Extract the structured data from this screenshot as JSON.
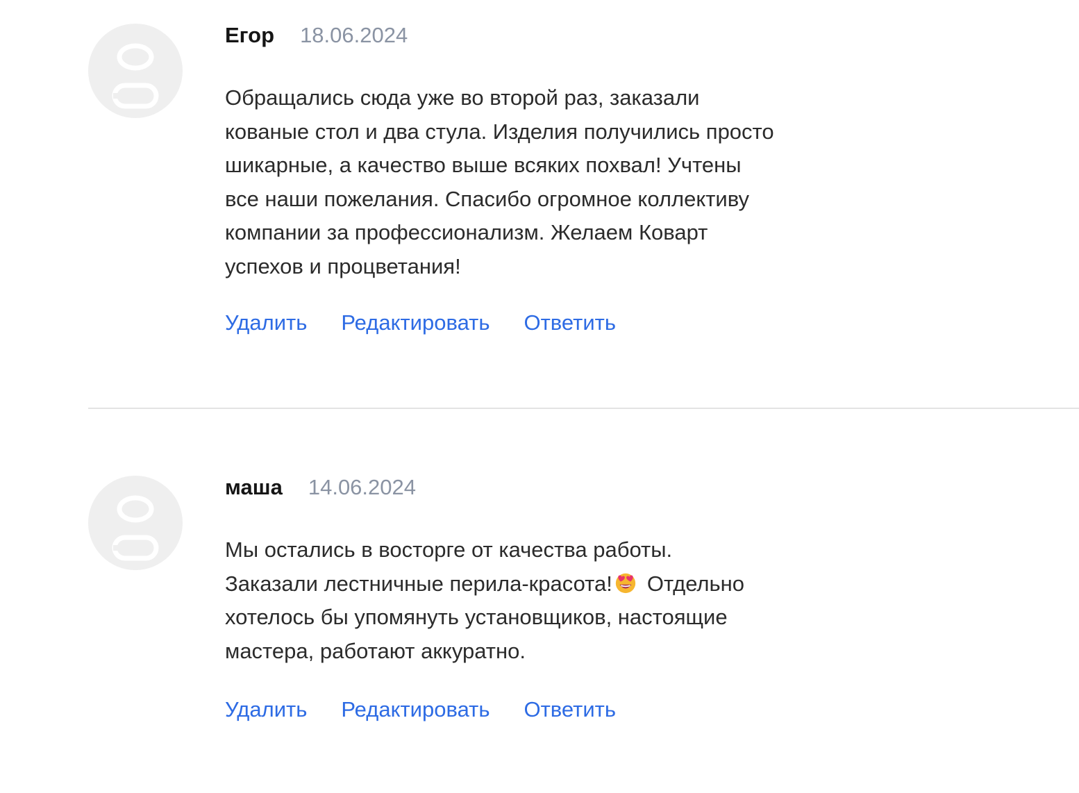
{
  "reviews": [
    {
      "author": "Егор",
      "date": "18.06.2024",
      "lines": [
        "Обращались сюда уже во второй раз, заказали",
        "кованые стол и два стула. Изделия получились просто",
        "шикарные, а качество выше всяких похвал! Учтены",
        "все наши пожелания. Спасибо огромное коллективу",
        "компании за профессионализм. Желаем Коварт",
        "успехов и процветания!"
      ],
      "actions": {
        "delete": "Удалить",
        "edit": "Редактировать",
        "reply": "Ответить"
      }
    },
    {
      "author": "маша",
      "date": "14.06.2024",
      "lines": [
        "Мы остались в восторге от качества работы.",
        "Заказали лестничные перила-красота!",
        "Отдельно",
        "хотелось бы упомянуть установщиков, настоящие",
        "мастера, работают аккуратно."
      ],
      "emoji": "heart-eyes-emoji",
      "actions": {
        "delete": "Удалить",
        "edit": "Редактировать",
        "reply": "Ответить"
      }
    }
  ],
  "colors": {
    "link": "#2d6be4",
    "date": "#8a93a3",
    "avatar_bg": "#efefef",
    "divider": "#e3e3e3"
  },
  "icons": {
    "avatar": "user-placeholder-icon"
  }
}
